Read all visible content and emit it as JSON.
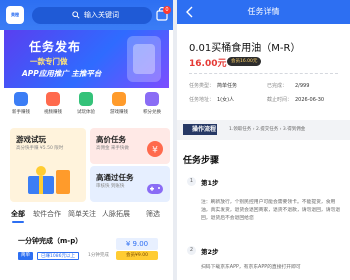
{
  "left": {
    "logo_text": "美橙",
    "search_placeholder": "输入关键词",
    "bag_badge": "0",
    "banner": {
      "title": "任务发布",
      "line1": "一款专门做",
      "line2": "APP应用推广 主推平台"
    },
    "icons": [
      {
        "label": "新手赚钱",
        "color": "#3b7df5"
      },
      {
        "label": "视频赚钱",
        "color": "#ff6a4d"
      },
      {
        "label": "试玩体验",
        "color": "#34c279"
      },
      {
        "label": "游戏赚钱",
        "color": "#ff9b2b"
      },
      {
        "label": "积分兑换",
        "color": "#8a6cf5"
      }
    ],
    "cards": [
      {
        "title": "游戏试玩",
        "subtitle": "高分快手赚 ¥5.50 限时",
        "bg": "#fff3dc"
      },
      {
        "title": "高价任务",
        "subtitle": "高佣金 来手快做",
        "bg": "#ffe9e6"
      },
      {
        "title": "高通过任务",
        "subtitle": "审核快 到账快",
        "bg": "#e6efff"
      }
    ],
    "tabs": [
      "全部",
      "软件合作",
      "简单关注",
      "人脉拓展",
      "筛选"
    ],
    "task": {
      "title": "一分钟完成（m-p）",
      "price": "¥ 9.00",
      "vip": "会员¥9.00",
      "tag1": "简单",
      "tag2": "已赚1086元以上",
      "tag3": "1分钟完成"
    }
  },
  "right": {
    "header_title": "任务详情",
    "task_name": "0.01买桶食用油（M-R）",
    "amount": "16.00元",
    "vip_badge": "会员16.00元",
    "meta": [
      {
        "k": "任务类型：",
        "v": "简单任务"
      },
      {
        "k": "已完成：",
        "v": "2/999"
      },
      {
        "k": "任务地址：",
        "v": "1(女)人"
      },
      {
        "k": "截止时间：",
        "v": "2026-06-30"
      }
    ],
    "flow_label": "操作流程",
    "flow_steps": "1.领取任务 › 2.提交任务 › 3.得到佣金",
    "steps_title": "任务步骤",
    "steps": [
      {
        "num": "1",
        "label": "第1步",
        "text": "注：刷新放行，个别民控用户可能会需要领卡。不能提货，食用油，真实发货，退货会退回商家，退货不退款，请勿退回，请勿退回，退货后不会退回给您"
      },
      {
        "num": "2",
        "label": "第2步",
        "text": "扫码下载京东APP，有京东APP的直接打开即可"
      }
    ]
  },
  "colors": {
    "primary": "#2d6ff2",
    "price_red": "#e53935",
    "vip_gold": "#ffcc33"
  }
}
